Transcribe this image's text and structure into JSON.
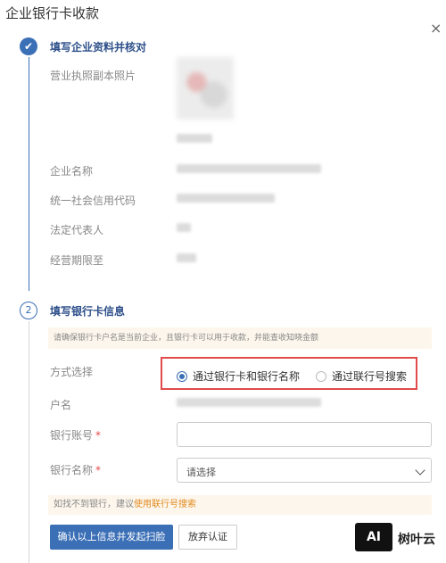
{
  "dialog": {
    "title": "企业银行卡收款",
    "close": "×"
  },
  "step1": {
    "icon": "✔",
    "title": "填写企业资料并核对",
    "labels": {
      "license": "营业执照副本照片",
      "company": "企业名称",
      "credit_code": "统一社会信用代码",
      "legal_rep": "法定代表人",
      "period": "经营期限至"
    }
  },
  "step2": {
    "num": "2",
    "title": "填写银行卡信息",
    "notice": "请确保银行卡户名是当前企业，且银行卡可以用于收款，并能查收知晓金额",
    "method_label": "方式选择",
    "options": [
      "通过银行卡和银行名称",
      "通过联行号搜索"
    ],
    "account_name_label": "户名",
    "account_no_label": "银行账号",
    "bank_name_label": "银行名称",
    "required_mark": "*",
    "select_placeholder": "请选择",
    "tip_prefix": "如找不到银行，建议",
    "tip_link": "使用联行号搜索"
  },
  "actions": {
    "submit": "确认以上信息并发起扫脸",
    "abandon": "放弃认证"
  },
  "watermark": {
    "logo": "AI",
    "text": "树叶云"
  },
  "colors": {
    "accent": "#3b6fb6",
    "highlight_border": "#e14b4b",
    "link": "#e08a1e"
  }
}
